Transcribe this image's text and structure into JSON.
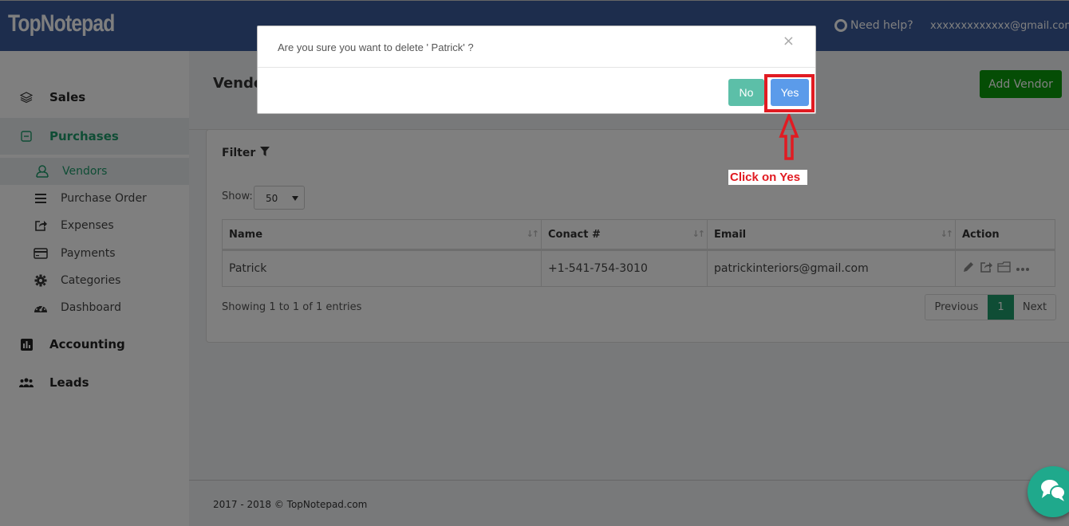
{
  "app": {
    "logo": "TopNotepad",
    "help_label": "Need help?",
    "user_email": "xxxxxxxxxxxxx@gmail.com"
  },
  "sidebar": {
    "sections": [
      {
        "label": "Sales",
        "icon": "layers-icon"
      },
      {
        "label": "Purchases",
        "icon": "minus-square-icon",
        "expanded": true
      },
      {
        "label": "Accounting",
        "icon": "bar-chart-icon"
      },
      {
        "label": "Leads",
        "icon": "users-icon"
      }
    ],
    "purchases_items": [
      {
        "label": "Vendors",
        "icon": "user-icon",
        "active": true
      },
      {
        "label": "Purchase Order",
        "icon": "list-icon"
      },
      {
        "label": "Expenses",
        "icon": "share-square-icon"
      },
      {
        "label": "Payments",
        "icon": "credit-card-icon"
      },
      {
        "label": "Categories",
        "icon": "gear-icon"
      },
      {
        "label": "Dashboard",
        "icon": "gauge-icon"
      }
    ]
  },
  "page": {
    "title": "Vendors",
    "add_button": "Add Vendor",
    "filter_label": "Filter",
    "show_label": "Show:",
    "show_value": "50",
    "table": {
      "columns": [
        "Name",
        "Conact #",
        "Email",
        "Action"
      ],
      "rows": [
        {
          "name": "Patrick",
          "contact": "+1-541-754-3010",
          "email": "patrickinteriors@gmail.com"
        }
      ]
    },
    "showing_text": "Showing 1 to 1 of 1 entries",
    "pagination": {
      "previous": "Previous",
      "current": "1",
      "next": "Next"
    },
    "footer": "2017 - 2018 © TopNotepad.com"
  },
  "modal": {
    "message": "Are you sure you want to delete ' Patrick' ?",
    "close": "×",
    "no_label": "No",
    "yes_label": "Yes"
  },
  "annotation": {
    "label": "Click on Yes",
    "color": "#e11b22"
  },
  "colors": {
    "navbar": "#3a5a9a",
    "accent_green": "#1e9a6a",
    "add_button": "#0b9a0b",
    "yes_button": "#5b9bea",
    "no_button": "#5cbfa8",
    "chat_fab": "#1fa98c"
  }
}
